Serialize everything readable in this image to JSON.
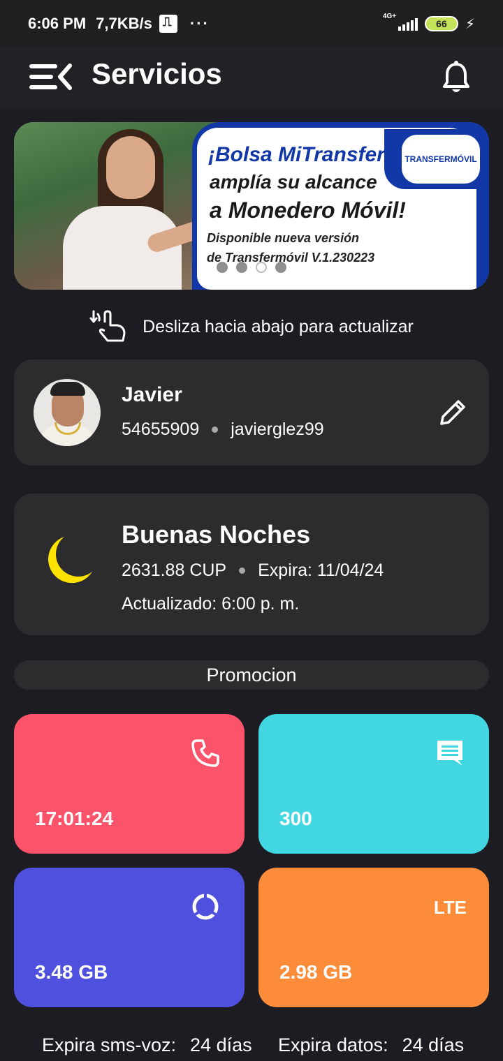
{
  "status_bar": {
    "time": "6:06 PM",
    "speed": "7,7KB/s",
    "more": "···",
    "network": "4G+",
    "battery": "66"
  },
  "app_bar": {
    "title": "Servicios"
  },
  "banner": {
    "headline1": "¡Bolsa MiTransfer",
    "headline2": "amplía su alcance",
    "headline3": "a Monedero Móvil!",
    "sub1": "Disponible nueva versión",
    "sub2": "de Transfermóvil V.1.230223",
    "logo": "TRANSFERMÓVIL",
    "page_count": 4,
    "active_page": 3
  },
  "refresh_hint": "Desliza hacia abajo para actualizar",
  "profile": {
    "name": "Javier",
    "phone": "54655909",
    "username": "javierglez99"
  },
  "balance": {
    "greeting": "Buenas Noches",
    "amount": "2631.88 CUP",
    "expires": "Expira: 11/04/24",
    "updated": "Actualizado: 6:00 p. m."
  },
  "promo_label": "Promocion",
  "tiles": {
    "voice": {
      "value": "17:01:24",
      "icon": "phone-icon",
      "color": "#fb5369"
    },
    "sms": {
      "value": "300",
      "icon": "message-icon",
      "color": "#42d6e2"
    },
    "data": {
      "value": "3.48 GB",
      "icon": "data-ring-icon",
      "color": "#4f50de"
    },
    "lte": {
      "value": "2.98 GB",
      "label": "LTE",
      "color": "#fd8c3a"
    }
  },
  "expiry": {
    "voice_label": "Expira sms-voz:",
    "voice_value": "24 días",
    "data_label": "Expira datos:",
    "data_value": "24 días"
  }
}
